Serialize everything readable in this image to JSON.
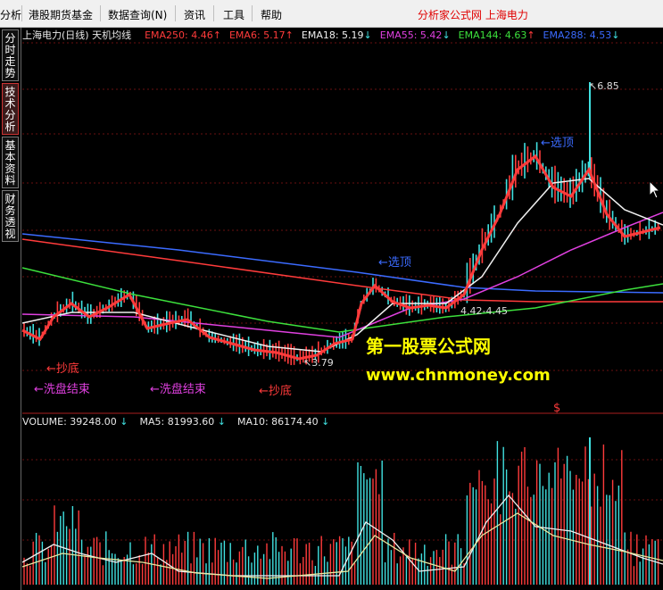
{
  "menu": {
    "items": [
      "分析",
      "港股期货基金",
      "数据查询(N)",
      "资讯",
      "工具",
      "帮助"
    ],
    "right_text": "分析家公式网 上海电力"
  },
  "sidebar": {
    "tabs": [
      "分时走势",
      "技术分析",
      "基本资料",
      "财务透视"
    ]
  },
  "chart": {
    "title": "上海电力(日线) 天机均线",
    "ema": [
      {
        "label": "EMA250:",
        "value": "4.46",
        "color": "#ff3b3b",
        "arrow": "up"
      },
      {
        "label": "EMA6:",
        "value": "5.17",
        "color": "#ff3b3b",
        "arrow": "up"
      },
      {
        "label": "EMA18:",
        "value": "5.19",
        "color": "#f0f0f0",
        "arrow": "down"
      },
      {
        "label": "EMA55:",
        "value": "5.42",
        "color": "#e040e0",
        "arrow": "down"
      },
      {
        "label": "EMA144:",
        "value": "4.63",
        "color": "#3ce03c",
        "arrow": "up"
      },
      {
        "label": "EMA288:",
        "value": "4.53",
        "color": "#3b6bff",
        "arrow": "down"
      }
    ],
    "annotations": {
      "top_price": "6.85",
      "low_price": "3.79",
      "range": "4.42-4.45",
      "select_top_1": "选顶",
      "select_top_2": "选顶",
      "buy_bottom_1": "抄底",
      "buy_bottom_2": "抄底",
      "wash_end_1": "洗盘结束",
      "wash_end_2": "洗盘结束",
      "s_marker": "$"
    },
    "watermark": {
      "line1": "第一股票公式网",
      "line2": "www.chnmoney.com"
    }
  },
  "volume": {
    "label": "VOLUME:",
    "value": "39248.00",
    "ma5_label": "MA5:",
    "ma5_value": "81993.60",
    "ma10_label": "MA10:",
    "ma10_value": "86174.40"
  },
  "colors": {
    "up": "#ff3b3b",
    "down": "#40e0e0",
    "ema250": "#ff3b3b",
    "ema18": "#f0f0f0",
    "ema55": "#e040e0",
    "ema144": "#3ce03c",
    "ema288": "#3b6bff",
    "annotation_blue": "#3b6bff",
    "annotation_red": "#ff3b3b",
    "watermark_text": "#ffff00"
  }
}
